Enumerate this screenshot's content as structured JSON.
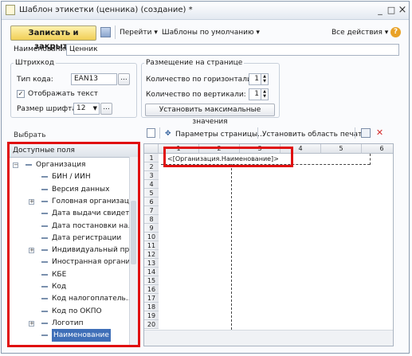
{
  "window": {
    "title": "Шаблон этикетки (ценника) (создание) *",
    "minimize": "_",
    "maximize": "□",
    "close": "×"
  },
  "toolbar": {
    "write_close": "Записать и закрыть",
    "goto": "Перейти ▾",
    "templates": "Шаблоны по умолчанию ▾",
    "all_actions": "Все действия ▾",
    "help": "?"
  },
  "name": {
    "label": "Наименование:",
    "value": "Ценник"
  },
  "barcode": {
    "title": "Штрихкод",
    "type_label": "Тип кода:",
    "type_value": "EAN13",
    "browse": "...",
    "show_text": "Отображать текст",
    "show_text_checked": true,
    "font_label": "Размер шрифта:",
    "font_value": "12",
    "font_browse": "..."
  },
  "placement": {
    "title": "Размещение на странице",
    "horiz_label": "Количество по горизонтали:",
    "horiz_value": "1",
    "vert_label": "Количество по вертикали:",
    "vert_value": "1",
    "max_button": "Установить максимальные значения"
  },
  "select_link": "Выбрать",
  "sheet_toolbar": {
    "page_params": "Параметры страницы...",
    "set_print_area": "Установить область печати"
  },
  "fields_panel": {
    "header": "Доступные поля",
    "items": [
      {
        "label": "Организация",
        "level": 0,
        "expander": "−"
      },
      {
        "label": "БИН / ИИН",
        "level": 1,
        "expander": ""
      },
      {
        "label": "Версия данных",
        "level": 1,
        "expander": ""
      },
      {
        "label": "Головная организац...",
        "level": 1,
        "expander": "+"
      },
      {
        "label": "Дата выдачи свидет...",
        "level": 1,
        "expander": ""
      },
      {
        "label": "Дата постановки на...",
        "level": 1,
        "expander": ""
      },
      {
        "label": "Дата регистрации",
        "level": 1,
        "expander": ""
      },
      {
        "label": "Индивидуальный пр...",
        "level": 1,
        "expander": "+"
      },
      {
        "label": "Иностранная органи...",
        "level": 1,
        "expander": ""
      },
      {
        "label": "КБЕ",
        "level": 1,
        "expander": ""
      },
      {
        "label": "Код",
        "level": 1,
        "expander": ""
      },
      {
        "label": "Код налогоплатель...",
        "level": 1,
        "expander": ""
      },
      {
        "label": "Код по ОКПО",
        "level": 1,
        "expander": ""
      },
      {
        "label": "Логотип",
        "level": 1,
        "expander": "+"
      },
      {
        "label": "Наименование",
        "level": 1,
        "expander": "",
        "selected": true
      }
    ]
  },
  "spreadsheet": {
    "columns": [
      "1",
      "2",
      "3",
      "4",
      "5",
      "6"
    ],
    "rows": [
      "1",
      "2",
      "3",
      "4",
      "5",
      "6",
      "7",
      "8",
      "9",
      "10",
      "11",
      "12",
      "13",
      "14",
      "15",
      "16",
      "17",
      "18",
      "19",
      "20"
    ],
    "cell_a1": "<[Организация.Наименование]>"
  },
  "colors": {
    "highlight": "#e01010",
    "selected_bg": "#3f6fb8",
    "primary_btn": "#f0cf55"
  }
}
